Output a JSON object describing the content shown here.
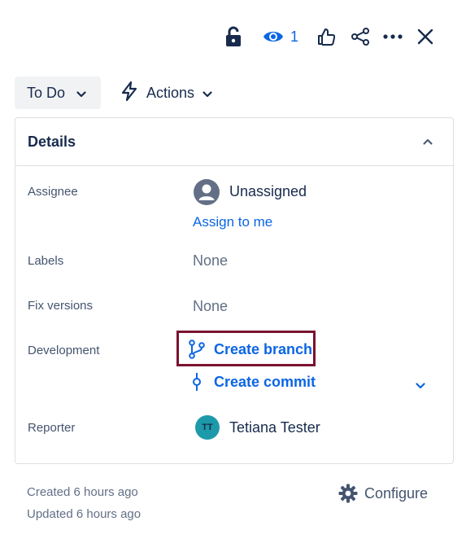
{
  "toolbar": {
    "icons": [
      "lock-open-icon",
      "watch-eye-icon",
      "thumbs-up-icon",
      "share-icon",
      "more-icon",
      "close-icon"
    ],
    "watch_count": "1"
  },
  "status": {
    "label": "To Do",
    "icon": "chevron-down-icon"
  },
  "actions": {
    "label": "Actions",
    "icon": "lightning-icon"
  },
  "details": {
    "title": "Details",
    "toggle_icon": "chevron-up-icon",
    "fields": {
      "assignee": {
        "label": "Assignee",
        "value": "Unassigned",
        "action": "Assign to me",
        "icon": "person-avatar-icon"
      },
      "labels": {
        "label": "Labels",
        "value": "None"
      },
      "fix_versions": {
        "label": "Fix versions",
        "value": "None"
      },
      "development": {
        "label": "Development",
        "create_branch": "Create branch",
        "create_commit": "Create commit",
        "branch_icon": "branch-icon",
        "commit_icon": "commit-icon"
      },
      "reporter": {
        "label": "Reporter",
        "initials": "TT",
        "name": "Tetiana Tester"
      }
    }
  },
  "footer": {
    "created": "Created 6 hours ago",
    "updated": "Updated 6 hours ago",
    "configure": "Configure",
    "configure_icon": "gear-icon"
  },
  "colors": {
    "link": "#0c66e4",
    "text": "#172b4d",
    "muted": "#626f86",
    "highlight_border": "#7b1230",
    "reporter_avatar": "#1d9aaa"
  }
}
